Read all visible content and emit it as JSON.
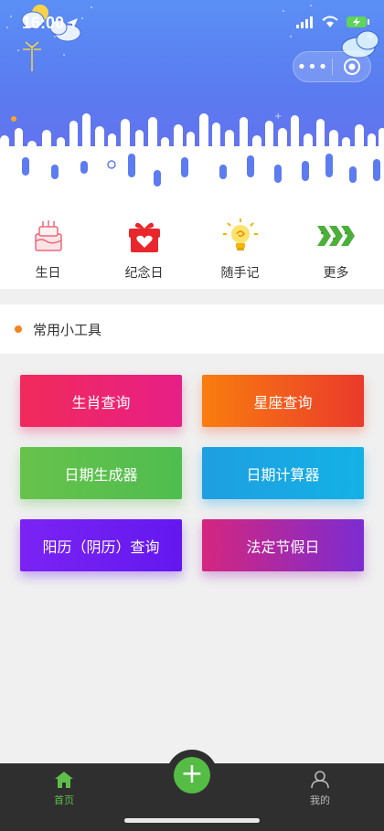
{
  "status_bar": {
    "time": "16:00"
  },
  "quick_entries": [
    {
      "label": "生日",
      "icon": "birthday-cake-icon"
    },
    {
      "label": "纪念日",
      "icon": "gift-box-icon"
    },
    {
      "label": "随手记",
      "icon": "lightbulb-icon"
    },
    {
      "label": "更多",
      "icon": "chevrons-more-icon"
    }
  ],
  "section": {
    "title": "常用小工具"
  },
  "tools": [
    {
      "label": "生肖查询"
    },
    {
      "label": "星座查询"
    },
    {
      "label": "日期生成器"
    },
    {
      "label": "日期计算器"
    },
    {
      "label": "阳历（阴历）查询"
    },
    {
      "label": "法定节假日"
    }
  ],
  "tabbar": {
    "home_label": "首页",
    "mine_label": "我的",
    "fab_label": "+"
  },
  "colors": {
    "accent_green": "#55bc45",
    "section_dot": "#f5821f",
    "tabbar_bg": "#2f2f2f"
  }
}
